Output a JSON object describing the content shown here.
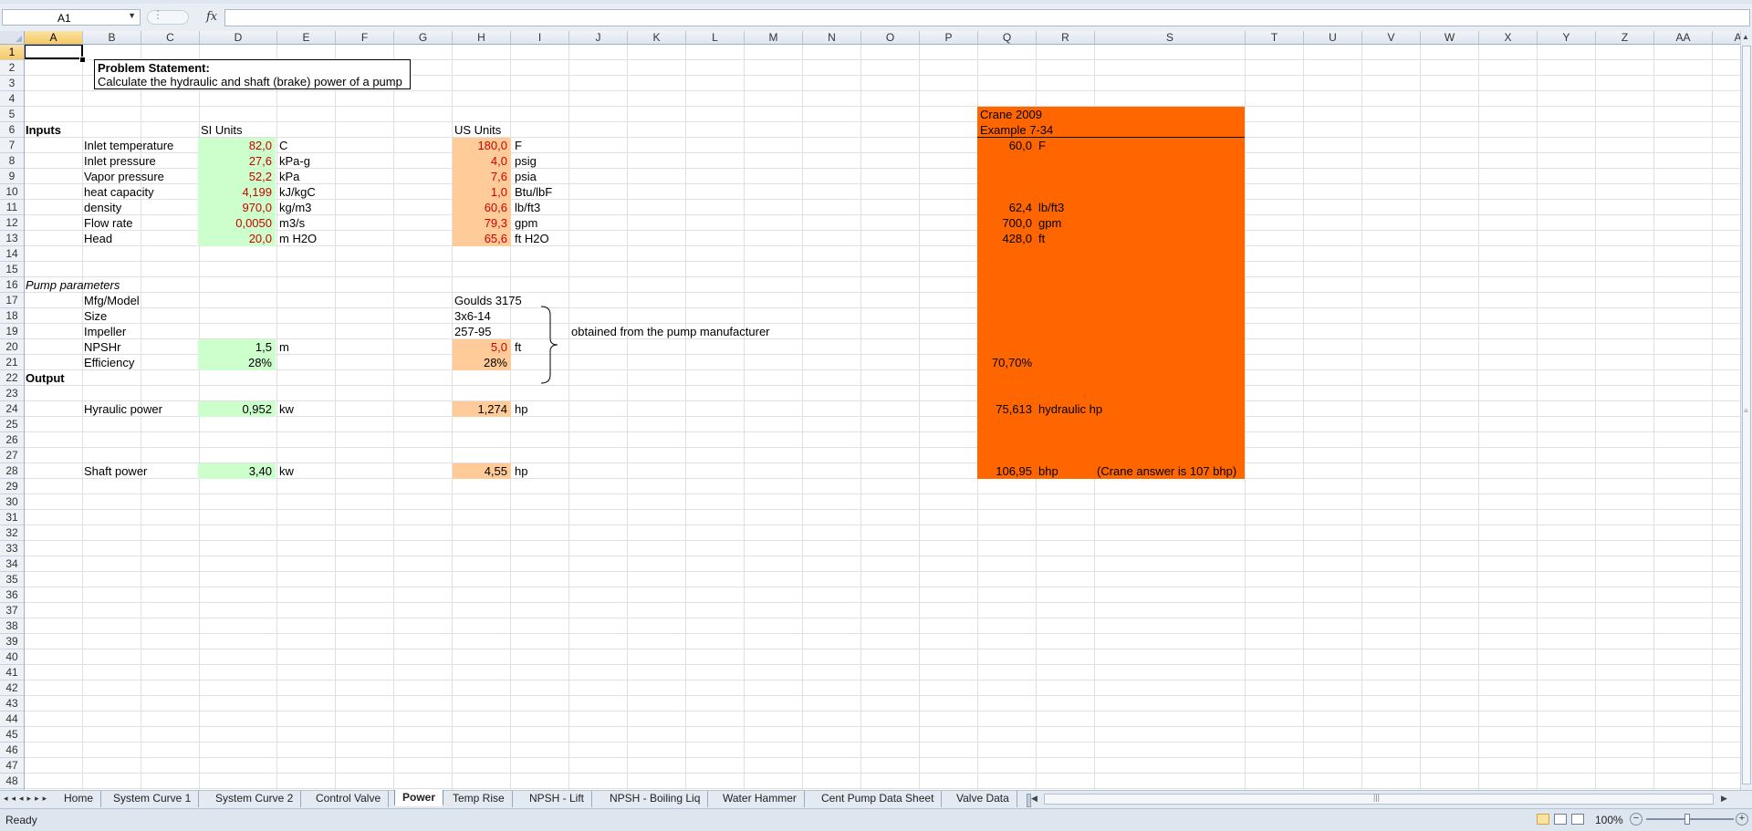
{
  "namebox": {
    "value": "A1"
  },
  "formula_bar": {
    "fx_label": "fx",
    "value": ""
  },
  "columns": [
    "A",
    "B",
    "C",
    "D",
    "E",
    "F",
    "G",
    "H",
    "I",
    "J",
    "K",
    "L",
    "M",
    "N",
    "O",
    "P",
    "Q",
    "R",
    "S",
    "T",
    "U",
    "V",
    "W",
    "X",
    "Y",
    "Z",
    "AA",
    "AB"
  ],
  "rows": [
    "1",
    "2",
    "3",
    "4",
    "5",
    "6",
    "7",
    "8",
    "9",
    "10",
    "11",
    "12",
    "13",
    "14",
    "15",
    "16",
    "17",
    "18",
    "19",
    "20",
    "21",
    "22",
    "23",
    "24",
    "25",
    "26",
    "27",
    "28",
    "29",
    "30",
    "31",
    "32",
    "33",
    "34",
    "35",
    "36",
    "37",
    "38",
    "39",
    "40",
    "41",
    "42",
    "43",
    "44",
    "45",
    "46",
    "47",
    "48"
  ],
  "selected_cell": {
    "column": "A",
    "row": "1"
  },
  "problem": {
    "title": "Problem Statement:",
    "text": "Calculate the hydraulic and shaft (brake) power of a pump"
  },
  "headers": {
    "inputs": "Inputs",
    "si_units": "SI Units",
    "us_units": "US Units",
    "pump_parameters": "Pump parameters",
    "output": "Output"
  },
  "inputs": [
    {
      "label": "Inlet temperature",
      "si_value": "82,0",
      "si_unit": "C",
      "us_value": "180,0",
      "us_unit": "F"
    },
    {
      "label": "Inlet pressure",
      "si_value": "27,6",
      "si_unit": "kPa-g",
      "us_value": "4,0",
      "us_unit": "psig"
    },
    {
      "label": "Vapor pressure",
      "si_value": "52,2",
      "si_unit": "kPa",
      "us_value": "7,6",
      "us_unit": "psia"
    },
    {
      "label": "heat capacity",
      "si_value": "4,199",
      "si_unit": "kJ/kgC",
      "us_value": "1,0",
      "us_unit": "Btu/lbF"
    },
    {
      "label": "density",
      "si_value": "970,0",
      "si_unit": "kg/m3",
      "us_value": "60,6",
      "us_unit": "lb/ft3"
    },
    {
      "label": "Flow rate",
      "si_value": "0,0050",
      "si_unit": "m3/s",
      "us_value": "79,3",
      "us_unit": "gpm"
    },
    {
      "label": "Head",
      "si_value": "20,0",
      "si_unit": "m H2O",
      "us_value": "65,6",
      "us_unit": "ft H2O"
    }
  ],
  "pump": {
    "mfg_label": "Mfg/Model",
    "mfg_value": "Goulds 3175",
    "size_label": "Size",
    "size_value": "3x6-14",
    "impeller_label": "Impeller",
    "impeller_value": "257-95",
    "brace_note": "obtained from the pump manufacturer",
    "npshr_label": "NPSHr",
    "npshr_si": "1,5",
    "npshr_si_unit": "m",
    "npshr_us": "5,0",
    "npshr_us_unit": "ft",
    "eff_label": "Efficiency",
    "eff_si": "28%",
    "eff_us": "28%"
  },
  "output": {
    "hyd_label": "Hyraulic power",
    "hyd_si": "0,952",
    "hyd_si_unit": "kw",
    "hyd_us": "1,274",
    "hyd_us_unit": "hp",
    "shaft_label": "Shaft power",
    "shaft_si": "3,40",
    "shaft_si_unit": "kw",
    "shaft_us": "4,55",
    "shaft_us_unit": "hp"
  },
  "crane": {
    "title": "Crane 2009",
    "example": "Example 7-34",
    "temp": "60,0",
    "temp_unit": "F",
    "density": "62,4",
    "density_unit": "lb/ft3",
    "flow": "700,0",
    "flow_unit": "gpm",
    "head": "428,0",
    "head_unit": "ft",
    "efficiency": "70,70%",
    "hyd_power": "75,613",
    "hyd_power_unit": "hydraulic hp",
    "shaft_power": "106,95",
    "shaft_power_unit": "bhp",
    "answer_note": "(Crane answer is 107 bhp)"
  },
  "sheet_tabs": [
    {
      "label": "Home",
      "active": false
    },
    {
      "label": "System Curve 1",
      "active": false
    },
    {
      "label": "System Curve 2",
      "active": false
    },
    {
      "label": "Control Valve",
      "active": false
    },
    {
      "label": "Power",
      "active": true
    },
    {
      "label": "Temp Rise",
      "active": false
    },
    {
      "label": "NPSH - Lift",
      "active": false
    },
    {
      "label": "NPSH - Boiling Liq",
      "active": false
    },
    {
      "label": "Water Hammer",
      "active": false
    },
    {
      "label": "Cent Pump Data Sheet",
      "active": false
    },
    {
      "label": "Valve Data",
      "active": false
    }
  ],
  "status": {
    "ready": "Ready",
    "zoom": "100%"
  },
  "colors": {
    "green_fill": "#ccffcc",
    "peach_fill": "#ffcc99",
    "orange_panel": "#ff6600",
    "input_red": "#cc0000"
  }
}
